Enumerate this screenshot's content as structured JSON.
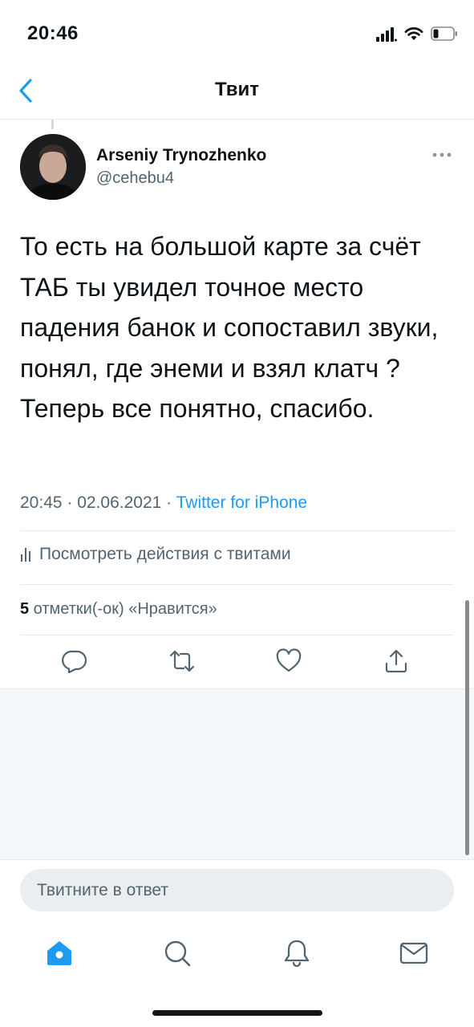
{
  "status_bar": {
    "time": "20:46"
  },
  "nav": {
    "title": "Твит"
  },
  "tweet": {
    "author_name": "Arseniy Trynozhenko",
    "author_handle": "@cehebu4",
    "text": "То есть на большой карте за счёт ТАБ ты увидел точное место падения банок и сопоставил звуки, понял, где энеми и взял клатч ? Теперь все понятно, спасибо.",
    "time": "20:45",
    "date": "02.06.2021",
    "source": "Twitter for iPhone",
    "separator": " · "
  },
  "activity_label": "Посмотреть действия с твитами",
  "likes": {
    "count": "5",
    "label": " отметки(-ок) «Нравится»"
  },
  "compose": {
    "placeholder": "Твитните в ответ"
  },
  "icons": {
    "back": "chevron-left-icon",
    "more": "more-dots-icon",
    "activity": "bar-chart-icon",
    "reply": "reply-icon",
    "retweet": "retweet-icon",
    "like": "heart-icon",
    "share": "share-icon",
    "home": "home-icon",
    "search": "search-icon",
    "notifications": "bell-icon",
    "messages": "mail-icon"
  },
  "colors": {
    "accent": "#1d9bf0",
    "secondary_text": "#536471",
    "text": "#0f1419"
  }
}
